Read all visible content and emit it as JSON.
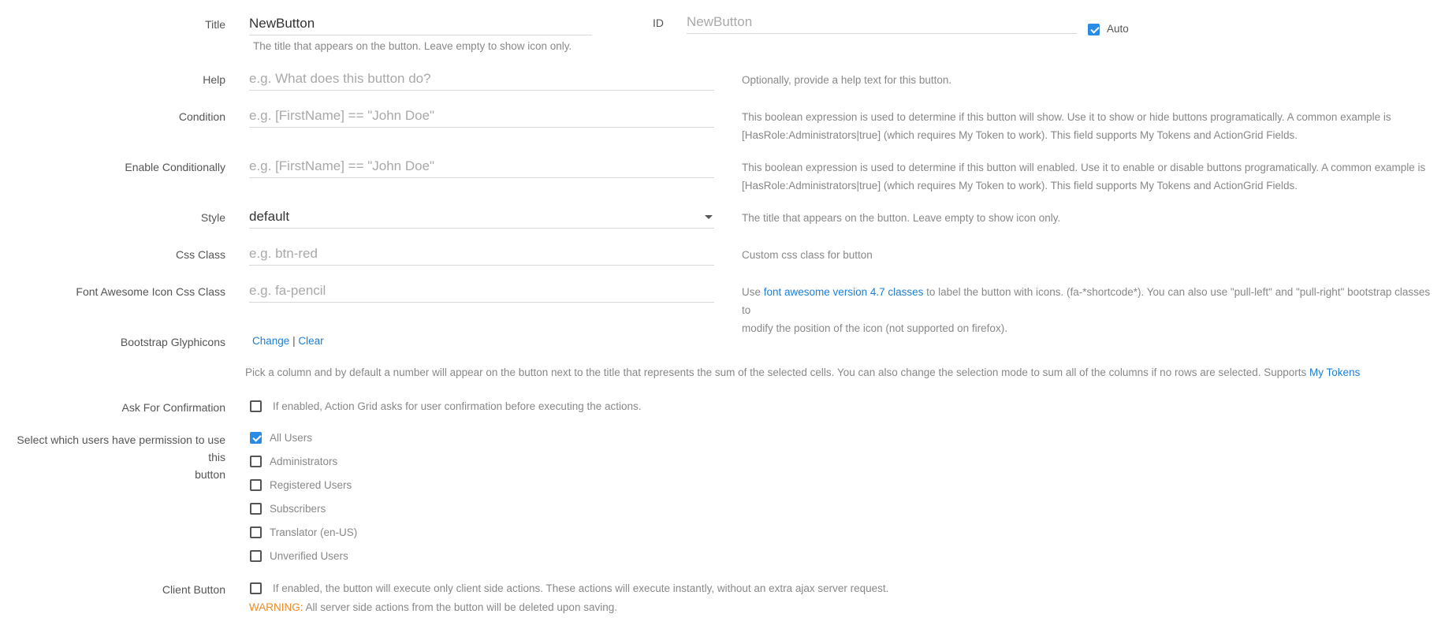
{
  "title": {
    "label": "Title",
    "value": "NewButton",
    "help": "The title that appears on the button. Leave empty to show icon only."
  },
  "id_field": {
    "label": "ID",
    "placeholder": "NewButton",
    "auto_label": "Auto",
    "auto_checked": true
  },
  "help_field": {
    "label": "Help",
    "placeholder": "e.g. What does this button do?",
    "help": "Optionally, provide a help text for this button."
  },
  "condition": {
    "label": "Condition",
    "placeholder": "e.g. [FirstName] == \"John Doe\"",
    "help_line1": "This boolean expression is used to determine if this button will show. Use it to show or hide buttons programatically. A common example is",
    "help_line2": "[HasRole:Administrators|true] (which requires My Token to work). This field supports My Tokens and ActionGrid Fields."
  },
  "enable_conditionally": {
    "label": "Enable Conditionally",
    "placeholder": "e.g. [FirstName] == \"John Doe\"",
    "help_line1": "This boolean expression is used to determine if this button will enabled. Use it to enable or disable buttons programatically. A common example is",
    "help_line2": "[HasRole:Administrators|true] (which requires My Token to work). This field supports My Tokens and ActionGrid Fields."
  },
  "style": {
    "label": "Style",
    "value": "default",
    "help": "The title that appears on the button. Leave empty to show icon only."
  },
  "css_class": {
    "label": "Css Class",
    "placeholder": "e.g. btn-red",
    "help": "Custom css class for button"
  },
  "font_awesome": {
    "label": "Font Awesome Icon Css Class",
    "placeholder": "e.g. fa-pencil",
    "help_pre": "Use ",
    "help_link": "font awesome version 4.7 classes",
    "help_post": " to label the button with icons. (fa-*shortcode*). You can also use \"pull-left\" and \"pull-right\" bootstrap classes to",
    "help_line2": "modify the position of the icon (not supported on firefox)."
  },
  "glyphicons": {
    "label": "Bootstrap Glyphicons",
    "change": "Change",
    "separator": "|",
    "clear": "Clear"
  },
  "sum_note": {
    "text": "Pick a column and by default a number will appear on the button next to the title that represents the sum of the selected cells. You can also change the selection mode to sum all of the columns if no rows are selected. Supports ",
    "link": "My Tokens"
  },
  "confirmation": {
    "label": "Ask For Confirmation",
    "text": "If enabled, Action Grid asks for user confirmation before executing the actions.",
    "checked": false
  },
  "permissions": {
    "label_line1": "Select which users have permission to use this",
    "label_line2": "button",
    "roles": [
      {
        "name": "All Users",
        "checked": true
      },
      {
        "name": "Administrators",
        "checked": false
      },
      {
        "name": "Registered Users",
        "checked": false
      },
      {
        "name": "Subscribers",
        "checked": false
      },
      {
        "name": "Translator (en-US)",
        "checked": false
      },
      {
        "name": "Unverified Users",
        "checked": false
      }
    ]
  },
  "client_button": {
    "label": "Client Button",
    "text": "If enabled, the button will execute only client side actions. These actions will execute instantly, without an extra ajax server request.",
    "warning_label": "WARNING:",
    "warning_text": " All server side actions from the button will be deleted upon saving.",
    "checked": false
  },
  "colors": {
    "accent": "#2a8be6",
    "link": "#1e7fd6",
    "warning": "#f08a24"
  }
}
